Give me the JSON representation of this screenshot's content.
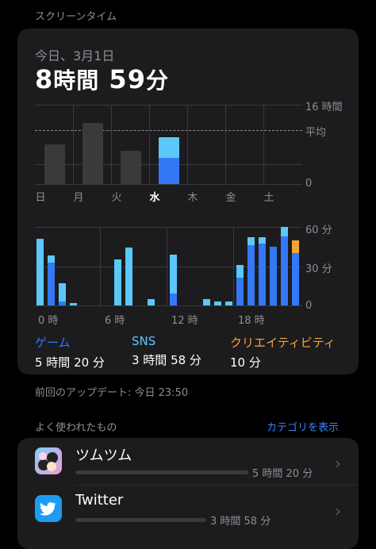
{
  "section_title": "スクリーンタイム",
  "date_label": "今日、3月1日",
  "total_time": {
    "hours": "8",
    "hours_unit": "時間",
    "minutes": "59",
    "minutes_unit": "分"
  },
  "colors": {
    "game": "#3478f6",
    "sns": "#5ac8fa",
    "creativity": "#f7a534",
    "grey_bar": "#3a3a3c",
    "accent": "#3a82f7"
  },
  "weekly_chart": {
    "y_max_label": "16 時間",
    "avg_label": "平均",
    "zero_label": "0",
    "days": [
      "日",
      "月",
      "火",
      "水",
      "木",
      "金",
      "土"
    ],
    "active_day": "水",
    "hours": [
      8.0,
      12.3,
      6.8,
      8.98
    ],
    "today_breakdown": {
      "game": 5.33,
      "sns": 3.97,
      "creativity": 0.17
    },
    "average": 9.0,
    "ylim": [
      0,
      16
    ]
  },
  "hourly_chart": {
    "y_labels": [
      "60 分",
      "30 分",
      "0"
    ],
    "x_labels": [
      "0 時",
      "6 時",
      "12 時",
      "18 時"
    ],
    "ylim": [
      0,
      60
    ],
    "hours": [
      {
        "game": 0,
        "sns": 51,
        "creativity": 0
      },
      {
        "game": 33,
        "sns": 5,
        "creativity": 0
      },
      {
        "game": 3,
        "sns": 14,
        "creativity": 0
      },
      {
        "game": 0,
        "sns": 2,
        "creativity": 0
      },
      {
        "game": 0,
        "sns": 0,
        "creativity": 0
      },
      {
        "game": 0,
        "sns": 0,
        "creativity": 0
      },
      {
        "game": 0,
        "sns": 0,
        "creativity": 0
      },
      {
        "game": 0,
        "sns": 35,
        "creativity": 0
      },
      {
        "game": 0,
        "sns": 44,
        "creativity": 0
      },
      {
        "game": 0,
        "sns": 0,
        "creativity": 0
      },
      {
        "game": 0,
        "sns": 5,
        "creativity": 0
      },
      {
        "game": 0,
        "sns": 0,
        "creativity": 0
      },
      {
        "game": 9,
        "sns": 30,
        "creativity": 0
      },
      {
        "game": 0,
        "sns": 0,
        "creativity": 0
      },
      {
        "game": 0,
        "sns": 0,
        "creativity": 0
      },
      {
        "game": 0,
        "sns": 5,
        "creativity": 0
      },
      {
        "game": 0,
        "sns": 3,
        "creativity": 0
      },
      {
        "game": 0,
        "sns": 3,
        "creativity": 0
      },
      {
        "game": 21,
        "sns": 10,
        "creativity": 0
      },
      {
        "game": 46,
        "sns": 6,
        "creativity": 0
      },
      {
        "game": 47,
        "sns": 5,
        "creativity": 0
      },
      {
        "game": 45,
        "sns": 0,
        "creativity": 0
      },
      {
        "game": 53,
        "sns": 7,
        "creativity": 0
      },
      {
        "game": 40,
        "sns": 0,
        "creativity": 10
      }
    ]
  },
  "legend": [
    {
      "name": "ゲーム",
      "value": "5 時間 20 分",
      "color": "#3478f6"
    },
    {
      "name": "SNS",
      "value": "3 時間 58 分",
      "color": "#5ac8fa"
    },
    {
      "name": "クリエイティビティ",
      "value": "10 分",
      "color": "#f7a534"
    }
  ],
  "last_update": "前回のアップデート: 今日 23:50",
  "most_used_header": "よく使われたもの",
  "show_categories": "カテゴリを表示",
  "apps": [
    {
      "name": "ツムツム",
      "usage": "5 時間 20 分",
      "fraction": 1.0
    },
    {
      "name": "Twitter",
      "usage": "3 時間 58 分",
      "fraction": 0.74
    }
  ]
}
